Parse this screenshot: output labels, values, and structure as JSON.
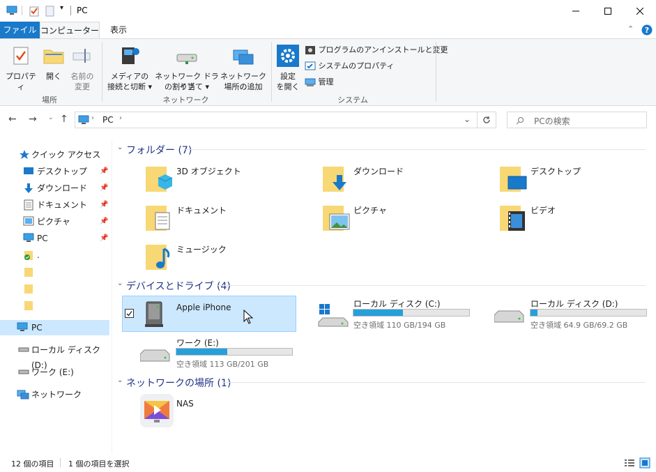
{
  "window": {
    "title": "PC",
    "minimize_icon": "minimize-icon",
    "maximize_icon": "maximize-icon",
    "close_icon": "close-icon"
  },
  "ribbon_tabs": [
    "ファイル",
    "コンピューター",
    "表示"
  ],
  "ribbon": {
    "location_group": {
      "name": "場所",
      "properties": [
        "プロパティ"
      ],
      "open": [
        "開く"
      ],
      "rename": [
        "名前の",
        "変更"
      ]
    },
    "network_group": {
      "name": "ネットワーク",
      "media": [
        "メディアの",
        "接続と切断 ▾"
      ],
      "map_drive": [
        "ネットワーク ドライブ",
        "の割り当て ▾"
      ],
      "add_location": [
        "ネットワークの",
        "場所の追加"
      ]
    },
    "system_group": {
      "name": "システム",
      "settings": [
        "設定",
        "を開く"
      ],
      "uninstall": "プログラムのアンインストールと変更",
      "system_properties": "システムのプロパティ",
      "manage": "管理"
    },
    "accent": "#1979ca"
  },
  "address": {
    "path_item": "PC",
    "search_placeholder": "PCの検索"
  },
  "sidebar": {
    "quick_access": "クイック アクセス",
    "pinned": [
      {
        "label": "デスクトップ",
        "icon": "desktop-icon"
      },
      {
        "label": "ダウンロード",
        "icon": "download-icon"
      },
      {
        "label": "ドキュメント",
        "icon": "documents-icon"
      },
      {
        "label": "ピクチャ",
        "icon": "pictures-icon"
      },
      {
        "label": "PC",
        "icon": "pc-icon"
      }
    ],
    "extra_folders": [
      ".",
      "",
      "",
      ""
    ],
    "this_pc": "PC",
    "local_disk": "ローカル ディスク (D:)",
    "work_drive": "ワーク (E:)",
    "network": "ネットワーク"
  },
  "content": {
    "folders_header": "フォルダー (7)",
    "folders": [
      {
        "label": "3D オブジェクト",
        "icon": "3d-objects-icon"
      },
      {
        "label": "ダウンロード",
        "icon": "downloads-folder-icon"
      },
      {
        "label": "デスクトップ",
        "icon": "desktop-folder-icon"
      },
      {
        "label": "ドキュメント",
        "icon": "documents-folder-icon"
      },
      {
        "label": "ピクチャ",
        "icon": "pictures-folder-icon"
      },
      {
        "label": "ビデオ",
        "icon": "videos-folder-icon"
      },
      {
        "label": "ミュージック",
        "icon": "music-folder-icon"
      }
    ],
    "devices_header": "デバイスとドライブ (4)",
    "devices": [
      {
        "label": "Apple iPhone",
        "icon": "iphone-device-icon",
        "selected": true
      },
      {
        "label": "ローカル ディスク (C:)",
        "icon": "windows-drive-icon",
        "free": "空き領域 110 GB/194 GB",
        "used_fraction": 0.43
      },
      {
        "label": "ローカル ディスク (D:)",
        "icon": "drive-icon",
        "free": "空き領域 64.9 GB/69.2 GB",
        "used_fraction": 0.06
      },
      {
        "label": "ワーク (E:)",
        "icon": "drive-icon",
        "free": "空き領域 113 GB/201 GB",
        "used_fraction": 0.44
      }
    ],
    "network_header": "ネットワークの場所 (1)",
    "network_items": [
      {
        "label": "NAS",
        "icon": "nas-media-icon"
      }
    ]
  },
  "status": {
    "item_count": "12 個の項目",
    "selection": "1 個の項目を選択"
  },
  "colors": {
    "selection_bg": "#cce8ff",
    "selection_border": "#99d1ff",
    "group_header": "#1e3287",
    "folder": "#f8d775"
  }
}
